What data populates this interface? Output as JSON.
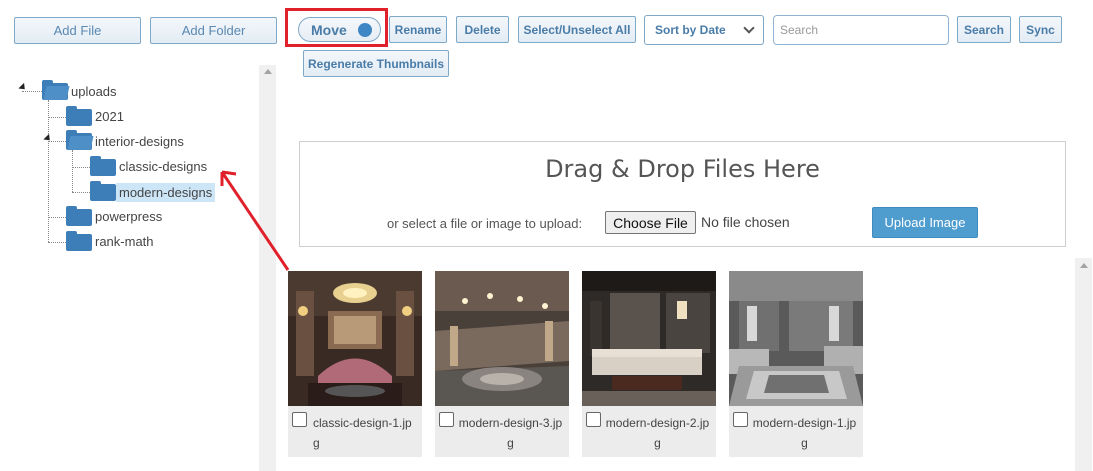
{
  "toolbar": {
    "add_file": "Add File",
    "add_folder": "Add Folder",
    "move": "Move",
    "rename": "Rename",
    "delete": "Delete",
    "select_all": "Select/Unselect All",
    "sort": "Sort by Date",
    "search_placeholder": "Search",
    "search_button": "Search",
    "sync": "Sync",
    "regenerate": "Regenerate Thumbnails"
  },
  "tree": {
    "root": "uploads",
    "items": [
      {
        "label": "2021"
      },
      {
        "label": "interior-designs"
      },
      {
        "label": "classic-designs"
      },
      {
        "label": "modern-designs"
      },
      {
        "label": "powerpress"
      },
      {
        "label": "rank-math"
      }
    ]
  },
  "dropzone": {
    "title": "Drag & Drop Files Here",
    "text": "or select a file or image to upload:",
    "choose_file": "Choose File",
    "no_file": "No file chosen",
    "upload": "Upload Image"
  },
  "files": [
    {
      "name": "classic-design-1.jpg"
    },
    {
      "name": "modern-design-3.jpg"
    },
    {
      "name": "modern-design-2.jpg"
    },
    {
      "name": "modern-design-1.jpg"
    }
  ],
  "colors": {
    "accent": "#3e7eb8",
    "highlight": "#e0202a",
    "upload_button": "#4f9ccf"
  }
}
